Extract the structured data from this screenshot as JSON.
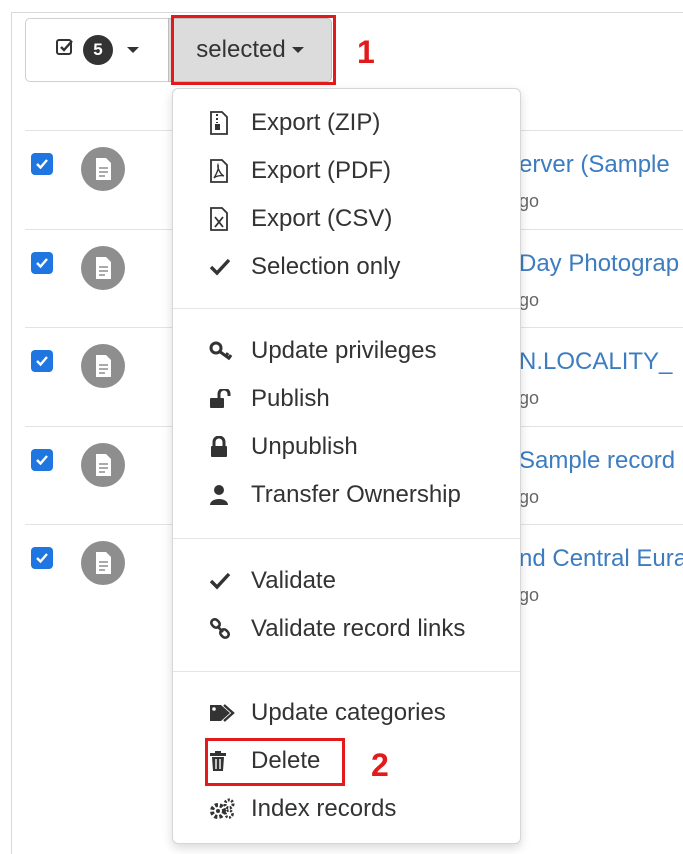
{
  "toolbar": {
    "selected_count": "5",
    "selected_label": "selected"
  },
  "annotations": {
    "first": "1",
    "second": "2"
  },
  "rows": [
    {
      "title": "erver (Sample",
      "time": "go",
      "checked": true
    },
    {
      "title": "Day Photograp",
      "time": "go",
      "checked": true
    },
    {
      "title": "N.LOCALITY_",
      "time": "go",
      "checked": true
    },
    {
      "title": "Sample record",
      "time": "go",
      "checked": true
    },
    {
      "title": "nd Central Eura",
      "time": "go",
      "checked": true
    }
  ],
  "menu": {
    "export_zip": "Export (ZIP)",
    "export_pdf": "Export (PDF)",
    "export_csv": "Export (CSV)",
    "selection_only": "Selection only",
    "update_privileges": "Update privileges",
    "publish": "Publish",
    "unpublish": "Unpublish",
    "transfer_ownership": "Transfer Ownership",
    "validate": "Validate",
    "validate_links": "Validate record links",
    "update_categories": "Update categories",
    "delete": "Delete",
    "index_records": "Index records"
  },
  "colors": {
    "accent": "#1f76e0",
    "link": "#3c7cc0",
    "annotation": "#e31a1c"
  }
}
